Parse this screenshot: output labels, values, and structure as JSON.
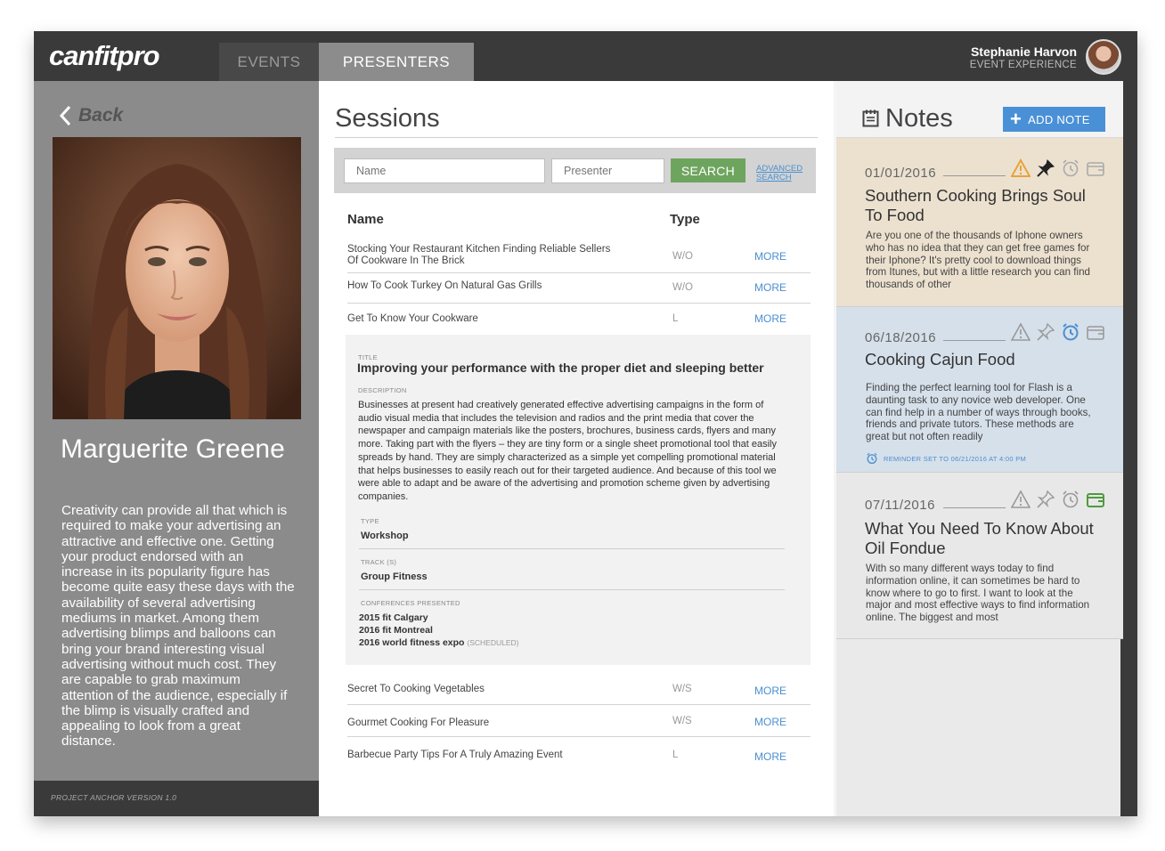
{
  "header": {
    "logo": "canfitpro",
    "tabs": [
      {
        "label": "EVENTS",
        "active": false
      },
      {
        "label": "PRESENTERS",
        "active": true
      }
    ],
    "user": {
      "name": "Stephanie Harvon",
      "role": "EVENT EXPERIENCE"
    }
  },
  "presenter": {
    "back_label": "Back",
    "name": "Marguerite Greene",
    "bio": "Creativity can provide all that which is required to make your advertising an attractive and effective one. Getting your product endorsed with an increase in its popularity figure has become quite easy these days with the availability of several advertising mediums in market. Among them advertising blimps and balloons can bring your brand interesting visual advertising without much cost. They are capable to grab maximum attention of the audience, especially if the blimp is visually crafted and appealing to look from a great distance.",
    "version": "PROJECT ANCHOR VERSION 1.0"
  },
  "sessions": {
    "title": "Sessions",
    "search": {
      "name_placeholder": "Name",
      "presenter_placeholder": "Presenter",
      "button": "SEARCH",
      "advanced": "ADVANCED SEARCH"
    },
    "columns": {
      "name": "Name",
      "type": "Type"
    },
    "more_label": "MORE",
    "rows_top": [
      {
        "name": "Stocking Your Restaurant Kitchen Finding Reliable Sellers Of Cookware In The Brick",
        "type": "W/O"
      },
      {
        "name": "How To Cook Turkey On Natural Gas Grills",
        "type": "W/O"
      },
      {
        "name": "Get To Know Your Cookware",
        "type": "L"
      }
    ],
    "detail": {
      "title_label": "TITLE",
      "title": "Improving your performance with the proper diet and sleeping better",
      "description_label": "DESCRIPTION",
      "description": "Businesses at present had creatively generated effective advertising campaigns in the form of audio visual media that includes the television and radios and the print media that cover the newspaper and campaign materials like the posters, brochures, business cards, flyers and many more. Taking part with the flyers – they are tiny form or a single sheet promotional tool that easily spreads by hand. They are simply characterized as a simple yet compelling promotional material that helps businesses to easily reach out for their targeted audience. And because of this tool we were able to adapt and be aware of the advertising and promotion scheme given by advertising companies.",
      "type_label": "TYPE",
      "type": "Workshop",
      "track_label": "TRACK (S)",
      "track": "Group Fitness",
      "conferences_label": "CONFERENCES PRESENTED",
      "conferences": [
        {
          "name": "2015 fit Calgary",
          "note": ""
        },
        {
          "name": "2016 fit Montreal",
          "note": ""
        },
        {
          "name": "2016 world fitness expo",
          "note": "(SCHEDULED)"
        }
      ]
    },
    "rows_bottom": [
      {
        "name": "Secret To Cooking Vegetables",
        "type": "W/S"
      },
      {
        "name": "Gourmet Cooking For Pleasure",
        "type": "W/S"
      },
      {
        "name": "Barbecue Party Tips For A Truly Amazing Event",
        "type": "L"
      }
    ]
  },
  "notes": {
    "title": "Notes",
    "add_label": "ADD NOTE",
    "items": [
      {
        "date": "01/01/2016",
        "title": "Southern Cooking Brings Soul To Food",
        "body": "Are you one of the thousands of Iphone owners who has no idea that they can get free games for their Iphone? It's pretty cool to download things from Itunes, but with a little research you can find thousands of other",
        "reminder": "",
        "accent": "#e8a33a"
      },
      {
        "date": "06/18/2016",
        "title": "Cooking Cajun Food",
        "body": "Finding the perfect learning tool for Flash is a daunting task to any novice web developer. One can find help in a number of ways through books, friends and private tutors. These methods are great but not often readily",
        "reminder": "REMINDER SET TO 06/21/2016 AT 4:00 PM",
        "accent": "#4a8fd0"
      },
      {
        "date": "07/11/2016",
        "title": "What You Need To Know About Oil Fondue",
        "body": "With so many different ways today to find information online, it can sometimes be hard to know where to go to first. I want to look at the major and most effective ways to find information online.  The biggest and most",
        "reminder": "",
        "accent": "#4f9a3f"
      }
    ]
  },
  "colors": {
    "header_bg": "#3a3a3a",
    "left_panel_bg": "#8b8b8b",
    "search_button": "#6ea55e",
    "link_blue": "#4a8fd0",
    "add_note_button": "#4a90d6",
    "note_1_bg": "#ece1cf",
    "note_2_bg": "#d6e0ea",
    "note_3_bg": "#e8e8e8"
  }
}
